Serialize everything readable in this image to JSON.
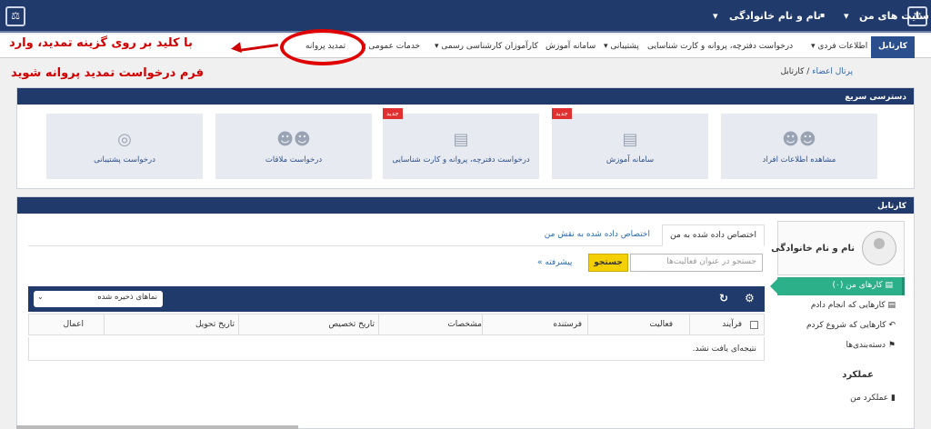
{
  "topbar": {
    "my_sites": "سایت های من",
    "user_name": "نام و نام خانوادگی"
  },
  "nav": {
    "kartabl": "کارتابل",
    "items": [
      {
        "label": "اطلاعات فردی",
        "caret": true
      },
      {
        "label": "درخواست دفترچه، پروانه و کارت شناسایی",
        "caret": false
      },
      {
        "label": "پشتیبانی",
        "caret": true
      },
      {
        "label": "سامانه آموزش",
        "caret": false
      },
      {
        "label": "کارآموزان کارشناسی رسمی",
        "caret": true
      },
      {
        "label": "خدمات عمومی",
        "caret": true
      },
      {
        "label": "تمدید پروانه",
        "caret": false
      }
    ]
  },
  "annotation": {
    "line1": "با کلید بر روی گزینه تمدید، وارد",
    "line2": "فرم درخواست تمدید پروانه شوید",
    "color": "#d00000"
  },
  "breadcrumb": {
    "root": "پرتال اعضاء",
    "sep": "/",
    "current": "کارتابل"
  },
  "quick_access": {
    "title": "دسترسی سریع",
    "tiles": [
      {
        "label": "مشاهده اطلاعات افراد",
        "icon": "users-icon",
        "glyph": "👥",
        "badge": ""
      },
      {
        "label": "سامانه آموزش",
        "icon": "book-icon",
        "glyph": "📖",
        "badge": "جدید"
      },
      {
        "label": "درخواست دفترچه، پروانه و کارت شناسایی",
        "icon": "book-icon",
        "glyph": "📖",
        "badge": "جدید"
      },
      {
        "label": "درخواست ملاقات",
        "icon": "users-icon",
        "glyph": "👥",
        "badge": ""
      },
      {
        "label": "درخواست پشتیبانی",
        "icon": "lifebuoy-icon",
        "glyph": "◎",
        "badge": ""
      }
    ]
  },
  "kartabl": {
    "title": "کارتابل",
    "profile_name": "نام و نام خانوادگی",
    "side": [
      {
        "label": "کارهای من (۰)",
        "icon": "inbox-icon"
      },
      {
        "label": "کارهایی که انجام دادم",
        "icon": "inbox-icon"
      },
      {
        "label": "کارهایی که شروع کردم",
        "icon": "reply-icon"
      },
      {
        "label": "دسته‌بندی‌ها",
        "icon": "tag-icon"
      }
    ],
    "performance_title": "عملکرد",
    "performance_item": "عملکرد من",
    "tabs": [
      "اختصاص داده شده به من",
      "اختصاص داده شده به نقش من"
    ],
    "search_placeholder": "جستجو در عنوان فعالیت‌ها",
    "search_btn": "جستجو",
    "advanced": "پیشرفته »",
    "saved_views": "نماهای ذخیره شده",
    "columns": [
      "فرآیند",
      "فعالیت",
      "فرستنده",
      "مشخصات",
      "تاریخ تخصیص",
      "تاریخ تحویل",
      "اعمال"
    ],
    "no_result": "نتیجه‌ای یافت نشد."
  }
}
